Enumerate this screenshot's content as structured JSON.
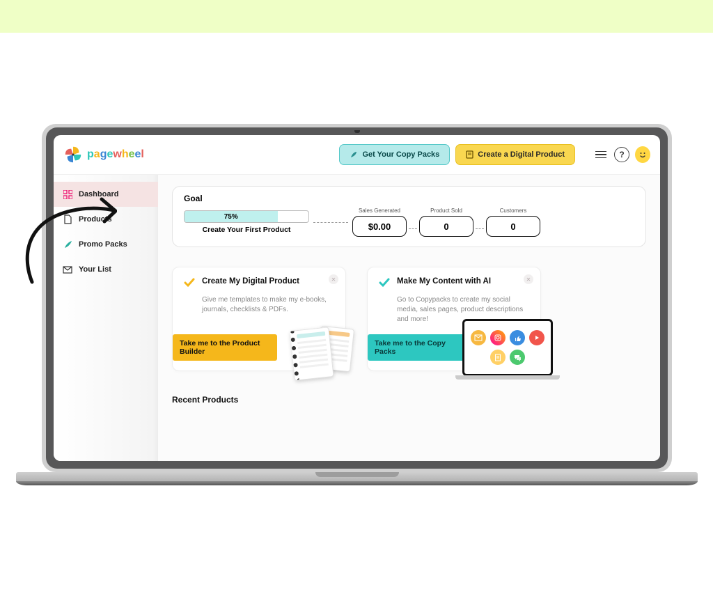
{
  "brand": {
    "name": "pagewheel"
  },
  "header": {
    "copy_packs_label": "Get Your Copy Packs",
    "create_product_label": "Create a Digital Product"
  },
  "sidebar": {
    "items": [
      {
        "label": "Dashboard",
        "key": "dashboard",
        "icon": "grid",
        "active": true
      },
      {
        "label": "Products",
        "key": "products",
        "icon": "file",
        "active": false
      },
      {
        "label": "Promo Packs",
        "key": "promo-packs",
        "icon": "rocket",
        "active": false
      },
      {
        "label": "Your List",
        "key": "your-list",
        "icon": "mail",
        "active": false
      }
    ]
  },
  "goal": {
    "heading": "Goal",
    "progress_pct": "75%",
    "progress_value": 75,
    "progress_caption": "Create Your First Product",
    "stats": {
      "sales_generated_label": "Sales Generated",
      "sales_generated_value": "$0.00",
      "product_sold_label": "Product Sold",
      "product_sold_value": "0",
      "customers_label": "Customers",
      "customers_value": "0"
    }
  },
  "cards": {
    "card1": {
      "title": "Create My Digital Product",
      "desc": "Give me templates to make my e-books, journals, checklists & PDFs.",
      "cta": "Take me to the Product Builder",
      "check_color": "#f5b71b"
    },
    "card2": {
      "title": "Make My Content with AI",
      "desc": "Go to Copypacks to create my social media, sales pages, product descriptions and more!",
      "cta": "Take me to the Copy Packs",
      "check_color": "#2dc7c0"
    }
  },
  "sections": {
    "recent_products": "Recent Products"
  },
  "colors": {
    "accent_teal": "#2dc7c0",
    "accent_yellow": "#f5b71b"
  }
}
